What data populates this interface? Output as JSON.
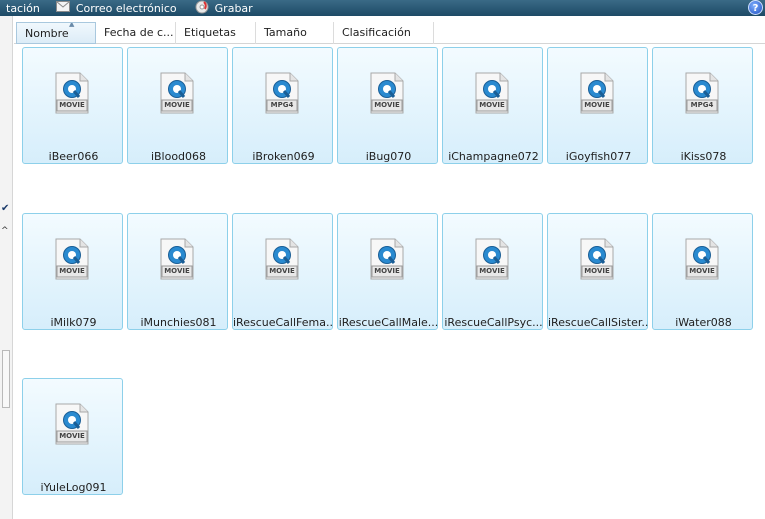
{
  "toolbar": {
    "items": [
      {
        "label": "tación",
        "icon": "none"
      },
      {
        "label": "Correo electrónico",
        "icon": "mail-icon"
      },
      {
        "label": "Grabar",
        "icon": "burn-disc-icon"
      }
    ],
    "help_label": "?"
  },
  "columns": [
    {
      "label": "Nombre",
      "sorted": true
    },
    {
      "label": "Fecha de c..."
    },
    {
      "label": "Etiquetas"
    },
    {
      "label": "Tamaño"
    },
    {
      "label": "Clasificación"
    }
  ],
  "files": [
    {
      "name": "iBeer066",
      "badge": "MOVIE"
    },
    {
      "name": "iBlood068",
      "badge": "MOVIE"
    },
    {
      "name": "iBroken069",
      "badge": "MPG4"
    },
    {
      "name": "iBug070",
      "badge": "MOVIE"
    },
    {
      "name": "iChampagne072",
      "badge": "MOVIE"
    },
    {
      "name": "iGoyfish077",
      "badge": "MOVIE"
    },
    {
      "name": "iKiss078",
      "badge": "MPG4"
    },
    {
      "name": "iMilk079",
      "badge": "MOVIE"
    },
    {
      "name": "iMunchies081",
      "badge": "MOVIE"
    },
    {
      "name": "iRescueCallFema...",
      "badge": "MOVIE"
    },
    {
      "name": "iRescueCallMale...",
      "badge": "MOVIE"
    },
    {
      "name": "iRescueCallPsyc...",
      "badge": "MOVIE"
    },
    {
      "name": "iRescueCallSister...",
      "badge": "MOVIE"
    },
    {
      "name": "iWater088",
      "badge": "MOVIE"
    },
    {
      "name": "iYuleLog091",
      "badge": "MOVIE"
    }
  ],
  "colors": {
    "toolbar_top": "#3a6a86",
    "tile_border": "#8dd0ea",
    "quicktime_blue": "#2a8ad0"
  }
}
